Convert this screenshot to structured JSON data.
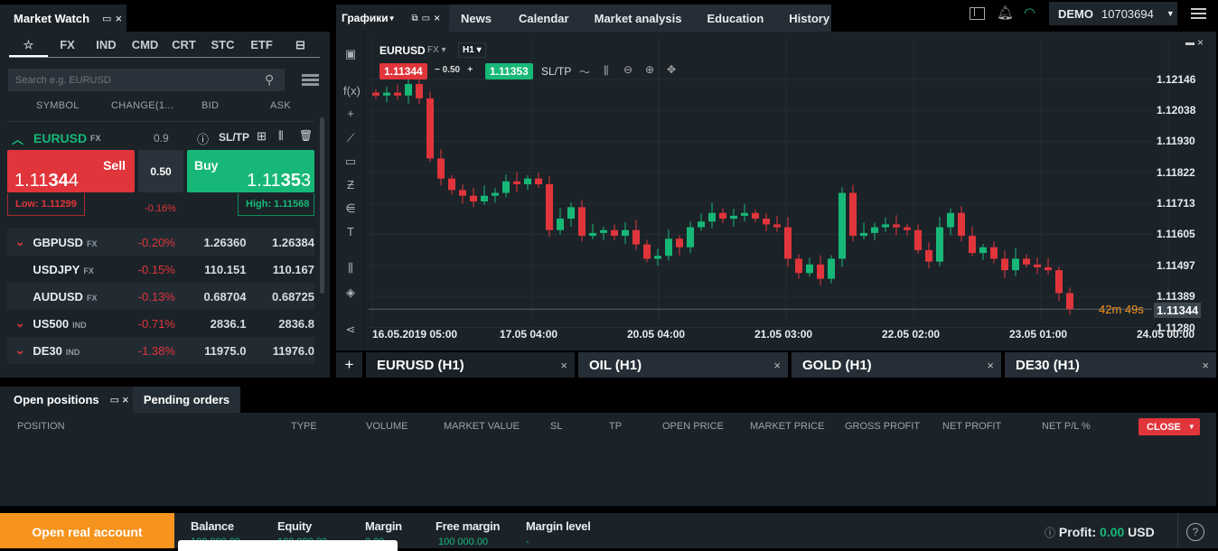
{
  "market_watch": {
    "title": "Market Watch",
    "filters": [
      "☆",
      "FX",
      "IND",
      "CMD",
      "CRT",
      "STC",
      "ETF"
    ],
    "search_placeholder": "Search e.g. EURUSD",
    "columns": [
      "SYMBOL",
      "CHANGE(1...",
      "BID",
      "ASK"
    ],
    "selected": {
      "symbol": "EURUSD",
      "type": "FX",
      "spread": "0.9",
      "sltp": "SL/TP",
      "sell_label": "Sell",
      "sell_pre": "1.11",
      "sell_big": "34",
      "sell_post": "4",
      "buy_label": "Buy",
      "buy_pre": "1.11",
      "buy_big": "35",
      "buy_post": "3",
      "volume": "0.50",
      "change": "-0.16%",
      "low": "Low: 1.11299",
      "high": "High: 1.11568"
    },
    "rows": [
      {
        "symbol": "GBPUSD",
        "type": "FX",
        "change": "-0.20%",
        "bid": "1.26360",
        "ask": "1.26384",
        "arrow": "down"
      },
      {
        "symbol": "USDJPY",
        "type": "FX",
        "change": "-0.15%",
        "bid": "110.151",
        "ask": "110.167",
        "arrow": ""
      },
      {
        "symbol": "AUDUSD",
        "type": "FX",
        "change": "-0.13%",
        "bid": "0.68704",
        "ask": "0.68725",
        "arrow": ""
      },
      {
        "symbol": "US500",
        "type": "IND",
        "change": "-0.71%",
        "bid": "2836.1",
        "ask": "2836.8",
        "arrow": "down"
      },
      {
        "symbol": "DE30",
        "type": "IND",
        "change": "-1.38%",
        "bid": "11975.0",
        "ask": "11976.0",
        "arrow": "down"
      }
    ]
  },
  "top_nav": {
    "charts": "Графики",
    "tabs": [
      "News",
      "Calendar",
      "Market analysis",
      "Education",
      "History"
    ],
    "account_type": "DEMO",
    "account_number": "10703694"
  },
  "chart": {
    "symbol": "EURUSD",
    "type": "FX",
    "timeframe": "H1",
    "sell": "1.11344",
    "volume": "0.50",
    "buy": "1.11353",
    "sltp": "SL/TP",
    "countdown_m": "42m",
    "countdown_s": "49s",
    "current_price": "1.11344",
    "price_ticks": [
      "1.12146",
      "1.12038",
      "1.11930",
      "1.11822",
      "1.11713",
      "1.11605",
      "1.11497",
      "1.11389",
      "1.11280"
    ],
    "time_ticks": [
      "16.05.2019 05:00",
      "17.05 04:00",
      "20.05 04:00",
      "21.05 03:00",
      "22.05 02:00",
      "23.05 01:00",
      "24.05 00:00"
    ],
    "closes": [
      1.1209,
      1.121,
      1.1209,
      1.1213,
      1.1208,
      1.1187,
      1.118,
      1.1176,
      1.1174,
      1.1172,
      1.1174,
      1.1175,
      1.1179,
      1.1178,
      1.118,
      1.1178,
      1.1162,
      1.1166,
      1.117,
      1.116,
      1.1161,
      1.1162,
      1.116,
      1.1162,
      1.1157,
      1.1152,
      1.1153,
      1.1159,
      1.1156,
      1.1163,
      1.1165,
      1.1168,
      1.1166,
      1.1167,
      1.1168,
      1.1166,
      1.1164,
      1.1163,
      1.1152,
      1.1147,
      1.115,
      1.1145,
      1.1152,
      1.1175,
      1.116,
      1.1161,
      1.1163,
      1.1164,
      1.1163,
      1.1162,
      1.1155,
      1.1151,
      1.1163,
      1.1168,
      1.116,
      1.1154,
      1.1156,
      1.1152,
      1.1148,
      1.1152,
      1.115,
      1.1149,
      1.1148,
      1.114,
      1.11344
    ],
    "up_color": "#17b877",
    "down_color": "#e0353b",
    "tabs": [
      "EURUSD (H1)",
      "OIL (H1)",
      "GOLD (H1)",
      "DE30 (H1)"
    ]
  },
  "positions": {
    "tab_open": "Open positions",
    "tab_pending": "Pending orders",
    "columns": [
      "POSITION",
      "TYPE",
      "VOLUME",
      "MARKET VALUE",
      "SL",
      "TP",
      "OPEN PRICE",
      "MARKET PRICE",
      "GROSS PROFIT",
      "NET PROFIT",
      "NET P/L %"
    ],
    "close_label": "CLOSE"
  },
  "footer": {
    "open_real": "Open real account",
    "balance_label": "Balance",
    "balance": "100 000.00",
    "equity_label": "Equity",
    "equity": "100 000.00",
    "margin_label": "Margin",
    "margin": "0.00",
    "free_margin_label": "Free margin",
    "free_margin": "100 000.00",
    "margin_level_label": "Margin level",
    "margin_level": "-",
    "profit_label": "Profit:",
    "profit": "0.00",
    "currency": "USD"
  },
  "colors": {
    "accent_orange": "#f7941d",
    "sell_red": "#e0353b",
    "buy_green": "#17b877"
  }
}
